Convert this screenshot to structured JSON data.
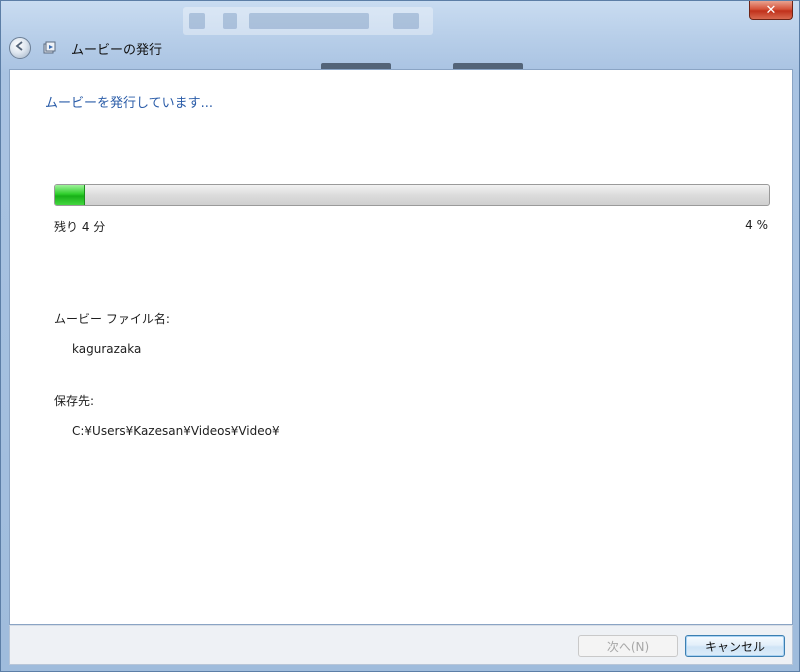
{
  "window": {
    "title": "ムービーの発行",
    "close_glyph": "✕"
  },
  "content": {
    "heading": "ムービーを発行しています...",
    "progress": {
      "value_fraction": 0.04,
      "remaining_label": "残り 4 分",
      "percent_label": "4 %"
    },
    "movie_file_label": "ムービー ファイル名:",
    "movie_file_value": "kagurazaka",
    "save_location_label": "保存先:",
    "save_location_value": "C:¥Users¥Kazesan¥Videos¥Video¥"
  },
  "footer": {
    "next_label": "次へ(N)",
    "cancel_label": "キャンセル"
  },
  "colors": {
    "heading": "#2a5ca8",
    "progress_fill": "#18b018",
    "close_button": "#c0311b"
  },
  "icons": {
    "back": "back-arrow-icon",
    "app": "movie-publish-icon",
    "close": "close-icon"
  }
}
